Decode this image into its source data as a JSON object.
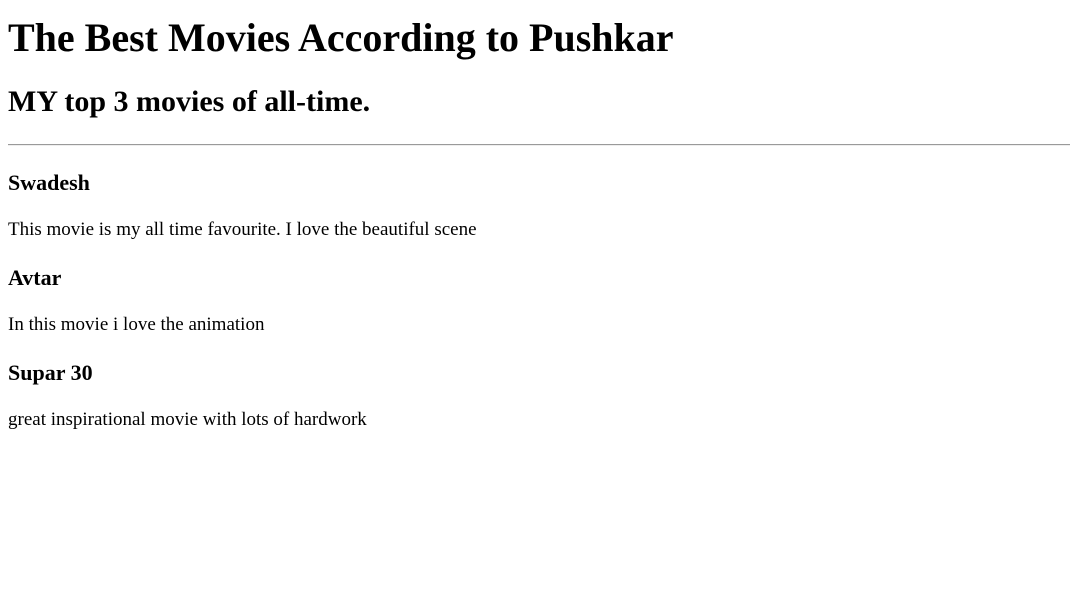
{
  "page": {
    "title": "The Best Movies According to Pushkar",
    "subtitle": "MY top 3 movies of all-time."
  },
  "movies": [
    {
      "title": "Swadesh",
      "description": "This movie is my all time favourite. I love the beautiful scene"
    },
    {
      "title": "Avtar",
      "description": "In this movie i love the animation"
    },
    {
      "title": "Supar 30",
      "description": "great inspirational movie with lots of hardwork"
    }
  ]
}
